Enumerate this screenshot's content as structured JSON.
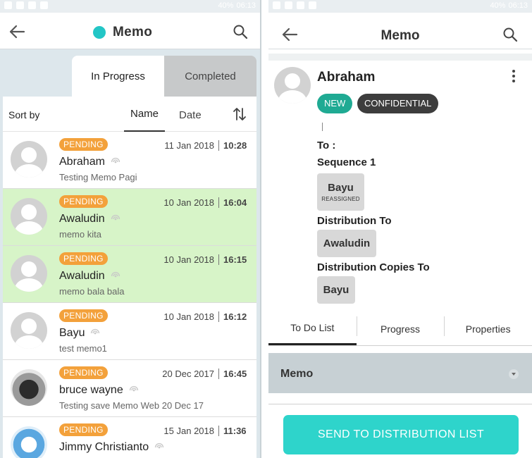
{
  "status_bar": {
    "battery": "40%",
    "time": "06:13"
  },
  "left": {
    "app_title": "Memo",
    "tabs": [
      {
        "label": "In Progress"
      },
      {
        "label": "Completed"
      }
    ],
    "sort": {
      "label": "Sort by",
      "name": "Name",
      "date": "Date"
    },
    "memos": [
      {
        "status": "PENDING",
        "date": "11 Jan 2018",
        "time": "10:28",
        "name": "Abraham",
        "subject": "Testing Memo Pagi",
        "highlight": false,
        "avatar": "placeholder"
      },
      {
        "status": "PENDING",
        "date": "10 Jan 2018",
        "time": "16:04",
        "name": "Awaludin",
        "subject": "memo kita",
        "highlight": true,
        "avatar": "placeholder"
      },
      {
        "status": "PENDING",
        "date": "10 Jan 2018",
        "time": "16:15",
        "name": "Awaludin",
        "subject": "memo bala bala",
        "highlight": true,
        "avatar": "placeholder"
      },
      {
        "status": "PENDING",
        "date": "10 Jan 2018",
        "time": "16:12",
        "name": "Bayu",
        "subject": "test memo1",
        "highlight": false,
        "avatar": "placeholder"
      },
      {
        "status": "PENDING",
        "date": "20 Dec 2017",
        "time": "16:45",
        "name": "bruce wayne",
        "subject": "Testing save Memo Web 20 Dec 17",
        "highlight": false,
        "avatar": "dog-photo"
      },
      {
        "status": "PENDING",
        "date": "15 Jan 2018",
        "time": "11:36",
        "name": "Jimmy Christianto",
        "subject": "",
        "highlight": false,
        "avatar": "aqua-photo"
      }
    ]
  },
  "right": {
    "app_title": "Memo",
    "sender": "Abraham",
    "chips": {
      "new": "NEW",
      "confidential": "CONFIDENTIAL"
    },
    "to_label": "To :",
    "sequence_label": "Sequence 1",
    "sequence_person": {
      "name": "Bayu",
      "note": "REASSIGNED"
    },
    "distribution_to_label": "Distribution To",
    "distribution_to_person": "Awaludin",
    "distribution_copies_label": "Distribution Copies To",
    "distribution_copies_person": "Bayu",
    "tabs": [
      {
        "label": "To Do List"
      },
      {
        "label": "Progress"
      },
      {
        "label": "Properties"
      }
    ],
    "dropdown_value": "Memo",
    "send_button": "SEND TO DISTRIBUTION LIST"
  },
  "colors": {
    "accent": "#23c6c6",
    "pending": "#f3a13b",
    "highlight_row": "#d7f4c8",
    "chip_new": "#1faa93",
    "chip_confidential": "#3d3d3d",
    "send_button": "#2ed4cb"
  }
}
